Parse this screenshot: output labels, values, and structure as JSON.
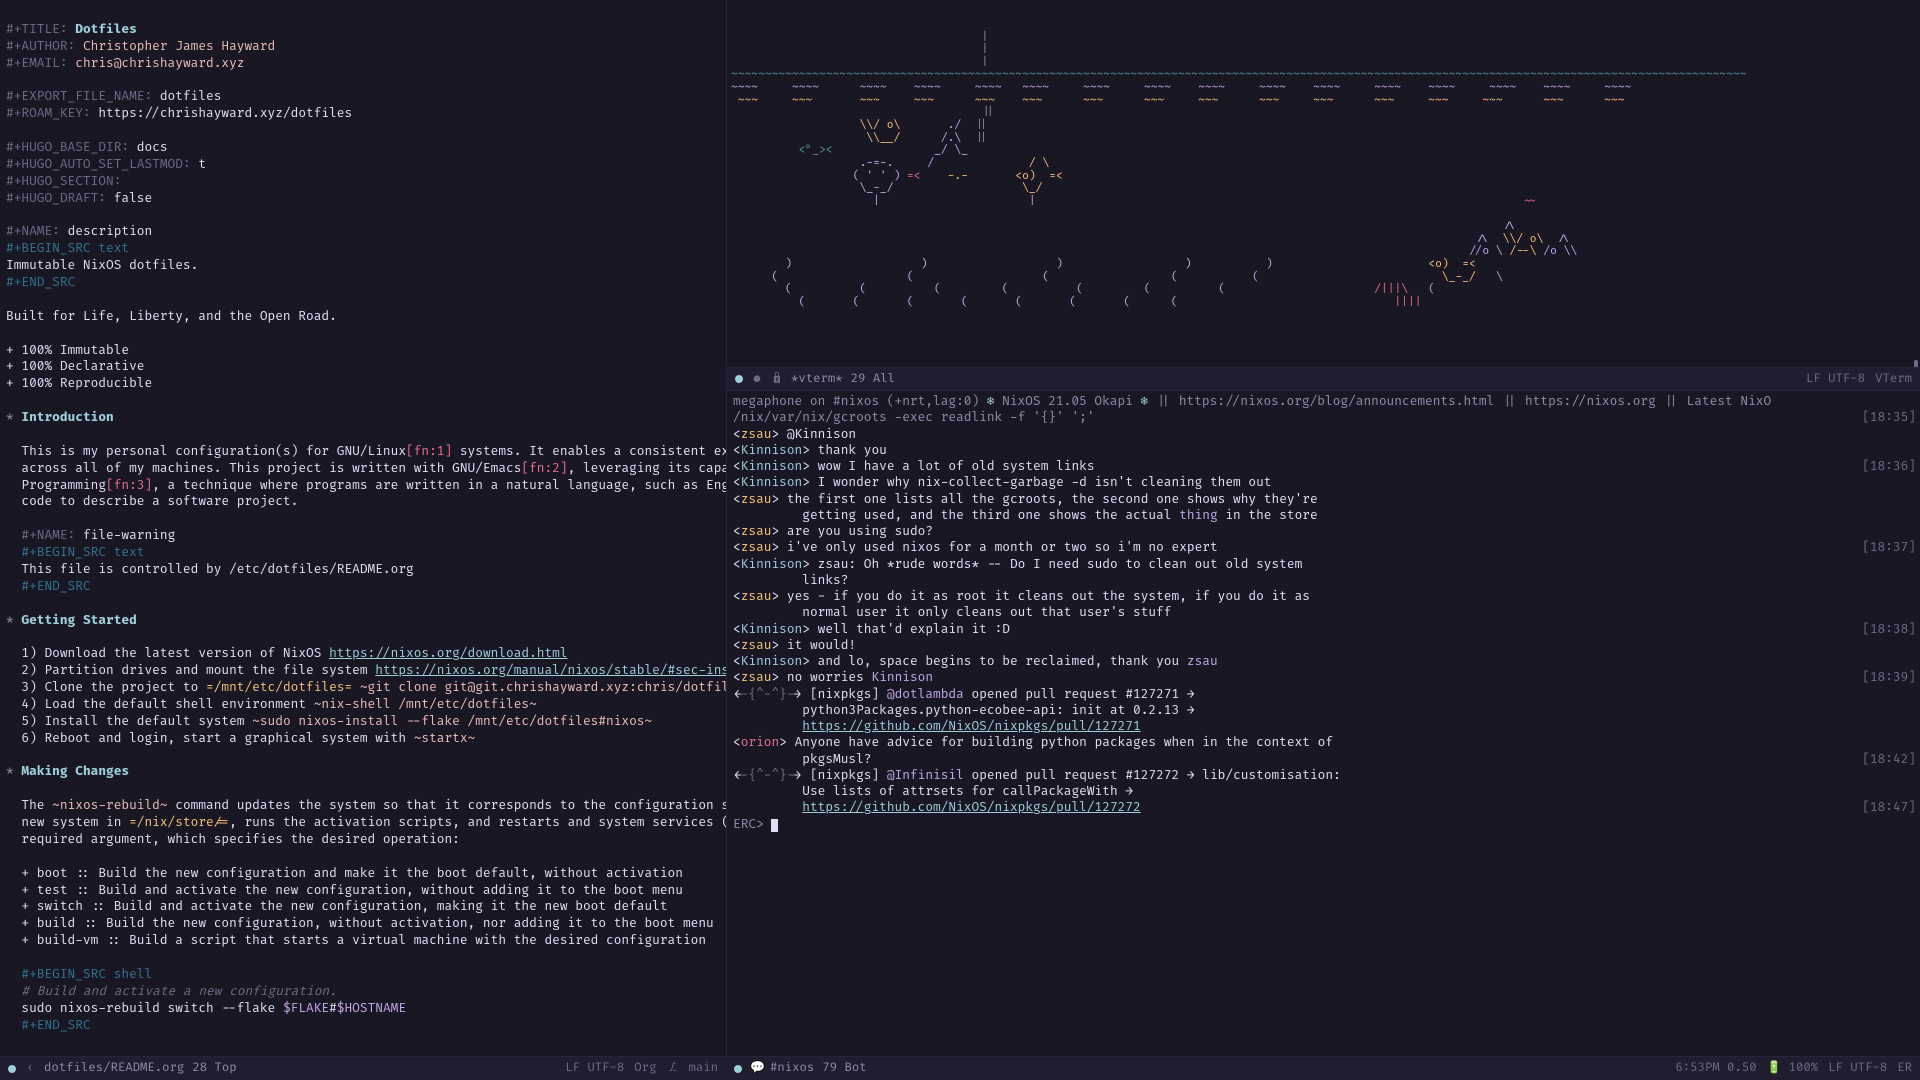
{
  "editor": {
    "headers": {
      "title_kw": "#+TITLE:",
      "title": "Dotfiles",
      "author_kw": "#+AUTHOR:",
      "author": "Christopher James Hayward",
      "email_kw": "#+EMAIL:",
      "email": "chris@chrishayward.xyz",
      "export_kw": "#+EXPORT_FILE_NAME:",
      "export": "dotfiles",
      "roam_kw": "#+ROAM_KEY:",
      "roam": "https://chrishayward.xyz/dotfiles",
      "hugo_base_kw": "#+HUGO_BASE_DIR:",
      "hugo_base": "docs",
      "hugo_lastmod_kw": "#+HUGO_AUTO_SET_LASTMOD:",
      "hugo_lastmod": "t",
      "hugo_section_kw": "#+HUGO_SECTION:",
      "hugo_draft_kw": "#+HUGO_DRAFT:",
      "hugo_draft": "false"
    },
    "block1": {
      "name_kw": "#+NAME:",
      "name": "description",
      "begin": "#+BEGIN_SRC text",
      "body": "Immutable NixOS dotfiles.",
      "end": "#+END_SRC"
    },
    "tagline": "Built for Life, Liberty, and the Open Road.",
    "bullets": [
      "+ 100% Immutable",
      "+ 100% Declarative",
      "+ 100% Reproducible"
    ],
    "h1": {
      "star": "*",
      "text": "Introduction"
    },
    "intro": {
      "l1a": "This is my personal configuration(s) for GNU/Linux",
      "fn1": "[fn:1]",
      "l1b": " systems. It enables a consistent experience and computing environment",
      "l2a": "across all of my machines. This project is written with GNU/Emacs",
      "fn2": "[fn:2]",
      "l2b": ", leveraging its capabilities for Literate",
      "l3a": "Programming",
      "fn3": "[fn:3]",
      "l3b": ", a technique where programs are written in a natural language, such as English, interspersed with snippets of",
      "l4": "code to describe a software project."
    },
    "block2": {
      "name_kw": "#+NAME:",
      "name": "file-warning",
      "begin": "#+BEGIN_SRC text",
      "body": "This file is controlled by /etc/dotfiles/README.org",
      "end": "#+END_SRC"
    },
    "h2": {
      "star": "*",
      "text": "Getting Started"
    },
    "steps": {
      "s1a": "1) Download the latest version of NixOS ",
      "s1link": "https://nixos.org/download.html",
      "s2a": "2) Partition drives and mount the file system ",
      "s2link": "https://nixos.org/manual/nixos/stable/#sec-installation-partitioning",
      "s3a": "3) Clone the project to ",
      "s3code1": "=/mnt/etc/dotfiles=",
      "s3code2": " ~git clone git@git.chrishayward.xyz:chris/dotfiles /mnt/etc/dotfiles~",
      "s4a": "4) Load the default shell environment ",
      "s4code": "~nix-shell /mnt/etc/dotfiles~",
      "s5a": "5) Install the default system ",
      "s5code": "~sudo nixos-install --flake /mnt/etc/dotfiles#nixos~",
      "s6a": "6) Reboot and login, start a graphical system with ",
      "s6code": "~startx~"
    },
    "h3": {
      "star": "*",
      "text": "Making Changes"
    },
    "changes": {
      "p1a": "The ",
      "p1code": "~nixos-rebuild~",
      "p1b": " command updates the system so that it corresponds to the configuration specified in the module. It builds the",
      "p2a": "new system in ",
      "p2code": "=/nix/store/=",
      "p2b": ", runs the activation scripts, and restarts and system services (if needed). The command has one",
      "p3": "required argument, which specifies the desired operation:"
    },
    "ops": [
      "+ boot :: Build the new configuration and make it the boot default, without activation",
      "+ test :: Build and activate the new configuration, without adding it to the boot menu",
      "+ switch :: Build and activate the new configuration, making it the new boot default",
      "+ build :: Build the new configuration, without activation, nor adding it to the boot menu",
      "+ build-vm :: Build a script that starts a virtual machine with the desired configuration"
    ],
    "block3": {
      "begin": "#+BEGIN_SRC shell",
      "comment": "# Build and activate a new configuration.",
      "cmd_a": "sudo nixos-rebuild switch --flake ",
      "cmd_var1": "$FLAKE",
      "cmd_mid": "#",
      "cmd_var2": "$HOSTNAME",
      "end": "#+END_SRC"
    }
  },
  "modeline_left": {
    "file": "dotfiles/README.org",
    "pos": "28 Top",
    "enc": "LF UTF-8",
    "mode": "Org",
    "branch_icon": "⎇",
    "branch": "main"
  },
  "vterm_modeline": {
    "name": "*vterm*",
    "pos": "29 All",
    "enc": "LF UTF-8",
    "mode": "VTerm"
  },
  "erc": {
    "header": {
      "pre": "megaphone on #nixos (+nrt,lag:0) ",
      "icon": "❄",
      "ver": " NixOS 21.05 Okapi ",
      "sep": "❄",
      "links": " || https://nixos.org/blog/announcements.html || https://nixos.org || Latest NixO",
      "sub": "/nix/var/nix/gcroots -exec readlink -f '{}' ';'",
      "ts": "[18:35]"
    },
    "lines": [
      {
        "n": "zsau",
        "cls": "nick-b",
        "m": "@Kinnison"
      },
      {
        "n": "Kinnison",
        "cls": "nick-a",
        "m": "thank you"
      },
      {
        "n": "Kinnison",
        "cls": "nick-a",
        "m": "wow I have a lot of old system links",
        "ts": "[18:36]"
      },
      {
        "n": "Kinnison",
        "cls": "nick-a",
        "m": "I wonder why nix-collect-garbage -d isn't cleaning them out"
      },
      {
        "n": "zsau",
        "cls": "nick-b",
        "m": "the first one lists all the gcroots, the second one shows why they're"
      },
      {
        "n": "",
        "cls": "",
        "m": "getting used, and the third one shows the actual thing in the store",
        "cont": true,
        "hl": "thing"
      },
      {
        "n": "zsau",
        "cls": "nick-b",
        "m": "are you using sudo?"
      },
      {
        "n": "zsau",
        "cls": "nick-b",
        "m": "i've only used nixos for a month or two so i'm no expert",
        "ts": "[18:37]"
      },
      {
        "n": "Kinnison",
        "cls": "nick-a",
        "m": "zsau: Oh *rude words* -- Do I need sudo to clean out old system"
      },
      {
        "n": "",
        "cls": "",
        "m": "links?",
        "cont": true
      },
      {
        "n": "zsau",
        "cls": "nick-b",
        "m": "yes - if you do it as root it cleans out the system, if you do it as"
      },
      {
        "n": "",
        "cls": "",
        "m": "normal user it only cleans out that user's stuff",
        "cont": true
      },
      {
        "n": "Kinnison",
        "cls": "nick-a",
        "m": "well that'd explain it :D",
        "ts": "[18:38]"
      },
      {
        "n": "zsau",
        "cls": "nick-b",
        "m": "it would!"
      },
      {
        "n": "Kinnison",
        "cls": "nick-a",
        "m": "and lo, space begins to be reclaimed, thank you zsau",
        "hl": "zsau"
      },
      {
        "n": "zsau",
        "cls": "nick-b",
        "m": "no worries Kinnison",
        "ts": "[18:39]",
        "hl": "Kinnison"
      },
      {
        "n": "-{^-^}-",
        "cls": "bot",
        "m": "[nixpkgs] @dotlambda opened pull request #127271 →",
        "hl": "@dotlambda"
      },
      {
        "n": "",
        "cls": "",
        "m": "python3Packages.python-ecobee-api: init at 0.2.13 →",
        "cont": true
      },
      {
        "n": "",
        "cls": "",
        "m": "https://github.com/NixOS/nixpkgs/pull/127271",
        "cont": true,
        "link": true
      },
      {
        "n": "orion",
        "cls": "nick-c",
        "m": "Anyone have advice for building python packages when in the context of"
      },
      {
        "n": "",
        "cls": "",
        "m": "pkgsMusl?",
        "cont": true,
        "ts": "[18:42]"
      },
      {
        "n": "-{^-^}-",
        "cls": "bot",
        "m": "[nixpkgs] @Infinisil opened pull request #127272 → lib/customisation:",
        "hl": "@Infinisil"
      },
      {
        "n": "",
        "cls": "",
        "m": "Use lists of attrsets for callPackageWith →",
        "cont": true
      },
      {
        "n": "",
        "cls": "",
        "m": "https://github.com/NixOS/nixpkgs/pull/127272",
        "cont": true,
        "link": true,
        "ts": "[18:47]"
      }
    ],
    "prompt": "ERC>"
  },
  "modeline_right": {
    "chan": "#nixos",
    "pos": "79 Bot",
    "time": "6:53PM 0.50",
    "batt_icon": "🔋",
    "batt": "100%",
    "enc": "LF UTF-8",
    "mode": "ER"
  }
}
